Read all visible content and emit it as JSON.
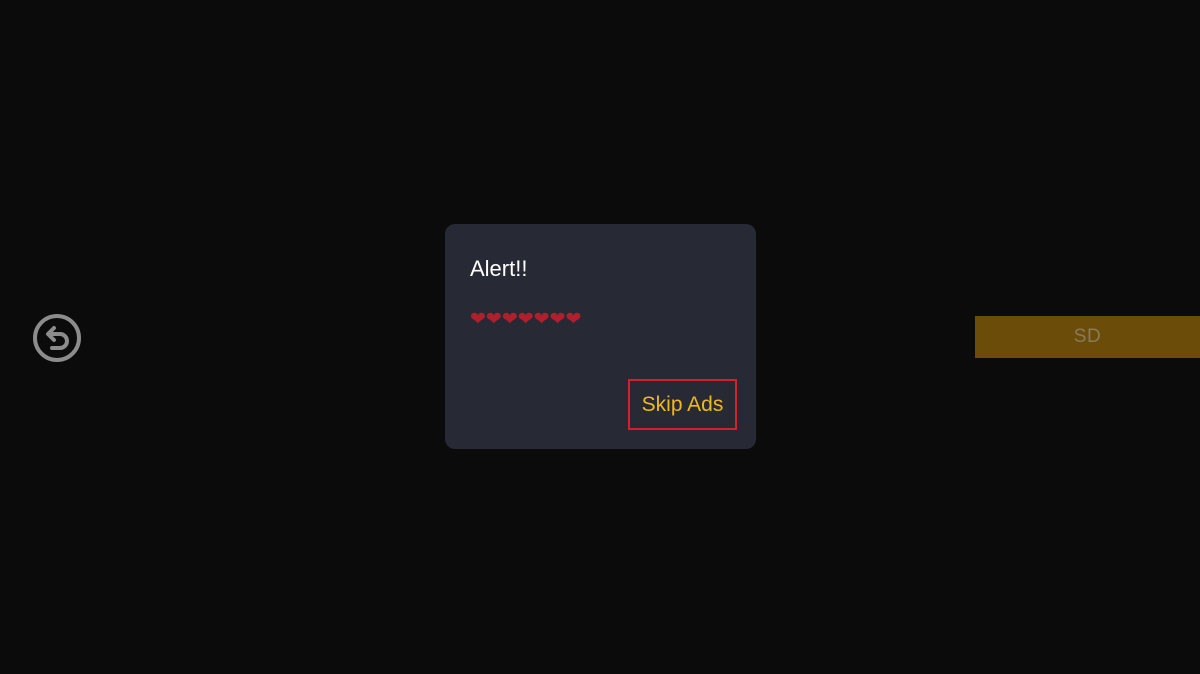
{
  "back": {
    "icon": "undo-back-icon"
  },
  "quality": {
    "label": "SD"
  },
  "dialog": {
    "title": "Alert!!",
    "message": "❤❤❤❤❤❤❤",
    "skip_label": "Skip Ads"
  },
  "colors": {
    "background": "#0b0b0b",
    "dialog_bg": "#272a34",
    "accent_yellow": "#f2b81a",
    "focus_border": "#d4202a",
    "quality_bar": "#6b4c08",
    "heart": "#b0202c"
  }
}
